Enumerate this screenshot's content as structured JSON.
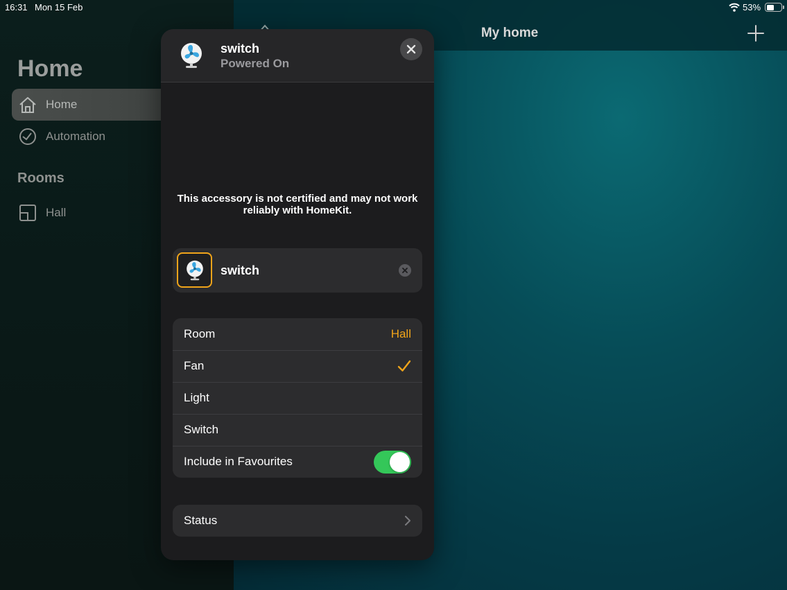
{
  "status_bar": {
    "time": "16:31",
    "date": "Mon 15 Feb",
    "battery_percent": "53%",
    "battery_level": 0.53
  },
  "sidebar": {
    "title": "Home",
    "items": [
      {
        "label": "Home",
        "icon": "house-icon",
        "active": true
      },
      {
        "label": "Automation",
        "icon": "clock-icon",
        "active": false
      }
    ],
    "rooms_heading": "Rooms",
    "rooms": [
      {
        "label": "Hall",
        "icon": "room-icon"
      }
    ]
  },
  "main": {
    "title": "My home"
  },
  "sheet": {
    "title": "switch",
    "subtitle": "Powered On",
    "warning": "This accessory is not certified and may not work reliably with HomeKit.",
    "name_field": {
      "value": "switch"
    },
    "rows": {
      "room_label": "Room",
      "room_value": "Hall",
      "fan_label": "Fan",
      "light_label": "Light",
      "switch_label": "Switch",
      "favourites_label": "Include in Favourites",
      "favourites_on": true
    },
    "status_label": "Status"
  },
  "colors": {
    "accent": "#f0a41a",
    "toggle_on": "#34c759",
    "sheet_bg": "#1c1c1e",
    "cell_bg": "#2c2c2e",
    "fan_blue": "#3aa6e0"
  }
}
